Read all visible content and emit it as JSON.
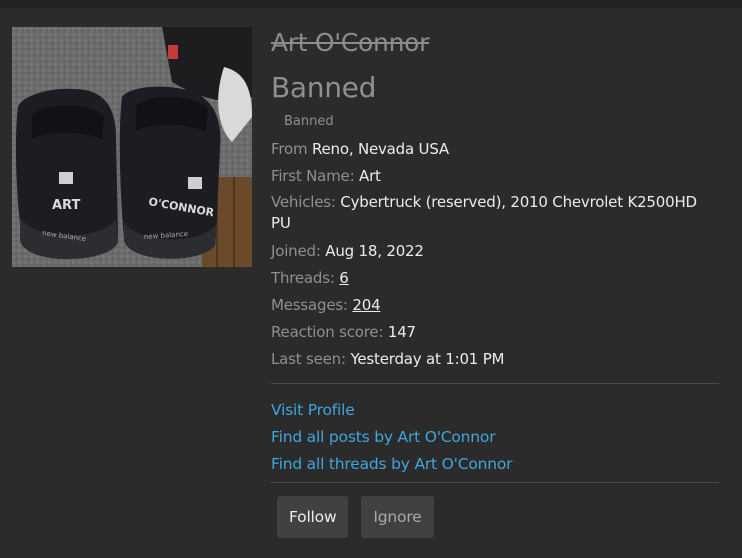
{
  "profile": {
    "username": "Art O'Connor",
    "user_title": "Banned",
    "banner": "Banned",
    "avatar_text": {
      "left_shoe": "ART",
      "right_shoe": "O'CONNOR",
      "sole_left": "new balance",
      "sole_right": "new balance"
    }
  },
  "details": {
    "from": {
      "label": "From",
      "value": "Reno, Nevada USA"
    },
    "first_name": {
      "label": "First Name:",
      "value": "Art"
    },
    "vehicles": {
      "label": "Vehicles:",
      "value": "Cybertruck (reserved), 2010 Chevrolet K2500HD PU"
    },
    "joined": {
      "label": "Joined:",
      "value": "Aug 18, 2022"
    },
    "threads": {
      "label": "Threads:",
      "value": "6"
    },
    "messages": {
      "label": "Messages:",
      "value": "204"
    },
    "reaction_score": {
      "label": "Reaction score:",
      "value": "147"
    },
    "last_seen": {
      "label": "Last seen:",
      "value": "Yesterday at 1:01 PM"
    }
  },
  "links": {
    "visit_profile": "Visit Profile",
    "find_posts": "Find all posts by Art O'Connor",
    "find_threads": "Find all threads by Art O'Connor"
  },
  "actions": {
    "follow": "Follow",
    "ignore": "Ignore"
  },
  "colors": {
    "background": "#2b2b2b",
    "link": "#3fa6dd",
    "button": "#414141"
  }
}
